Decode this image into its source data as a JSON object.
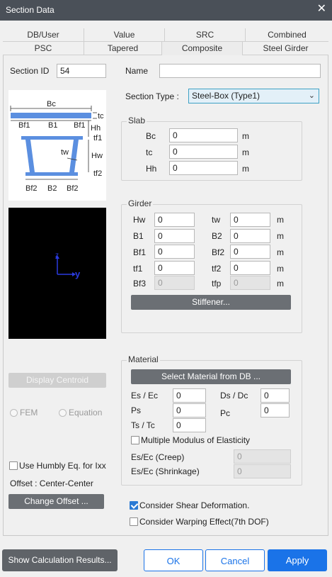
{
  "window": {
    "title": "Section Data",
    "close_glyph": "✕"
  },
  "tabs_row1": [
    "DB/User",
    "Value",
    "SRC",
    "Combined"
  ],
  "tabs_row2": [
    "PSC",
    "Tapered",
    "Composite",
    "Steel Girder"
  ],
  "section_id": {
    "label": "Section ID",
    "value": "54"
  },
  "name": {
    "label": "Name",
    "value": ""
  },
  "section_type": {
    "label": "Section Type :",
    "value": "Steel-Box (Type1)"
  },
  "diagram": {
    "Bc": "Bc",
    "tc": "tc",
    "Bf1": "Bf1",
    "B1": "B1",
    "Hh": "Hh",
    "tf1": "tf1",
    "tw": "tw",
    "Hw": "Hw",
    "tf2": "tf2",
    "Bf2": "Bf2",
    "B2": "B2"
  },
  "axes": {
    "z": "z",
    "y": "y"
  },
  "slab": {
    "title": "Slab",
    "rows": [
      {
        "label": "Bc",
        "value": "0",
        "unit": "m"
      },
      {
        "label": "tc",
        "value": "0",
        "unit": "m"
      },
      {
        "label": "Hh",
        "value": "0",
        "unit": "m"
      }
    ]
  },
  "girder": {
    "title": "Girder",
    "left": [
      {
        "label": "Hw",
        "value": "0"
      },
      {
        "label": "B1",
        "value": "0"
      },
      {
        "label": "Bf1",
        "value": "0"
      },
      {
        "label": "tf1",
        "value": "0"
      },
      {
        "label": "Bf3",
        "value": "0"
      }
    ],
    "right": [
      {
        "label": "tw",
        "value": "0",
        "unit": "m"
      },
      {
        "label": "B2",
        "value": "0",
        "unit": "m"
      },
      {
        "label": "Bf2",
        "value": "0",
        "unit": "m"
      },
      {
        "label": "tf2",
        "value": "0",
        "unit": "m"
      },
      {
        "label": "tfp",
        "value": "0",
        "unit": "m"
      }
    ],
    "stiffener_label": "Stiffener..."
  },
  "material": {
    "title": "Material",
    "select_db_label": "Select Material from DB ...",
    "es_ec": {
      "label": "Es / Ec",
      "value": "0"
    },
    "ds_dc": {
      "label": "Ds / Dc",
      "value": "0"
    },
    "ps": {
      "label": "Ps",
      "value": "0"
    },
    "pc": {
      "label": "Pc",
      "value": "0"
    },
    "ts_tc": {
      "label": "Ts / Tc",
      "value": "0"
    },
    "multiple_modulus": {
      "label": "Multiple Modulus of Elasticity",
      "checked": false
    },
    "creep": {
      "label": "Es/Ec (Creep)",
      "value": "0"
    },
    "shrinkage": {
      "label": "Es/Ec (Shrinkage)",
      "value": "0"
    }
  },
  "left_controls": {
    "display_centroid": "Display Centroid",
    "fem": "FEM",
    "equation": "Equation",
    "humbly": "Use Humbly Eq. for Ixx",
    "offset": "Offset :  Center-Center",
    "change_offset": "Change Offset ..."
  },
  "options": {
    "shear": {
      "label": "Consider Shear Deformation.",
      "checked": true
    },
    "warping": {
      "label": "Consider Warping Effect(7th DOF)",
      "checked": false
    }
  },
  "footer": {
    "show_calc": "Show Calculation Results...",
    "ok": "OK",
    "cancel": "Cancel",
    "apply": "Apply"
  },
  "colors": {
    "accent": "#1a73e8",
    "titlebar": "#4a5058",
    "diagram_blue": "#5b8fe0"
  }
}
